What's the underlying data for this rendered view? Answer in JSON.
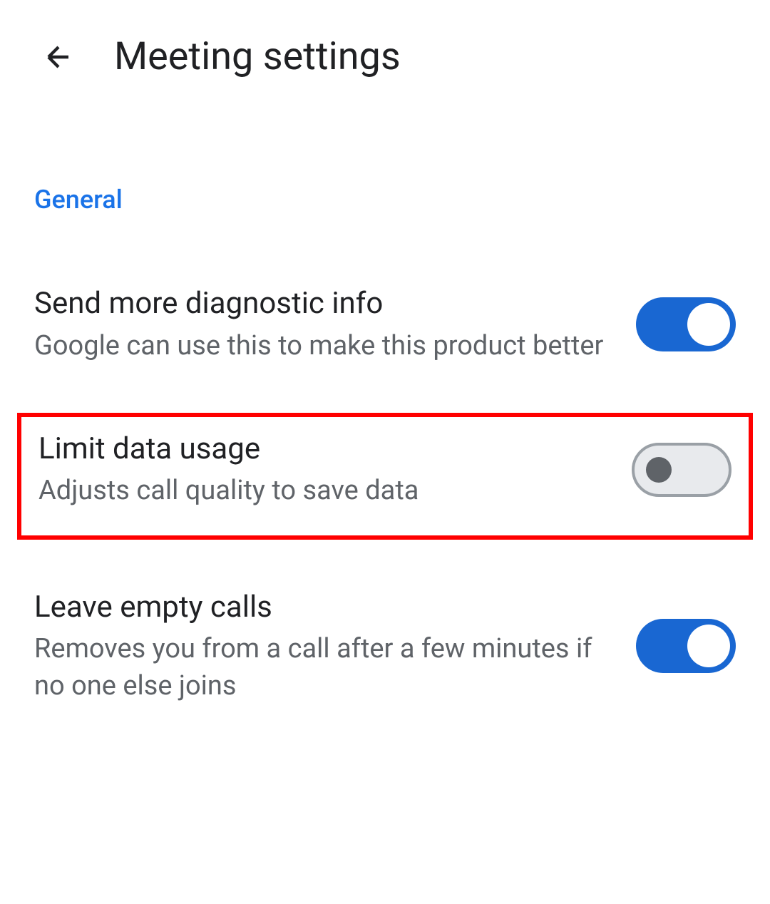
{
  "header": {
    "title": "Meeting settings"
  },
  "section": {
    "label": "General"
  },
  "settings": [
    {
      "title": "Send more diagnostic info",
      "description": "Google can use this to make this product better",
      "enabled": true,
      "highlighted": false
    },
    {
      "title": "Limit data usage",
      "description": "Adjusts call quality to save data",
      "enabled": false,
      "highlighted": true
    },
    {
      "title": "Leave empty calls",
      "description": "Removes you from a call after a few minutes if no one else joins",
      "enabled": true,
      "highlighted": false
    }
  ]
}
